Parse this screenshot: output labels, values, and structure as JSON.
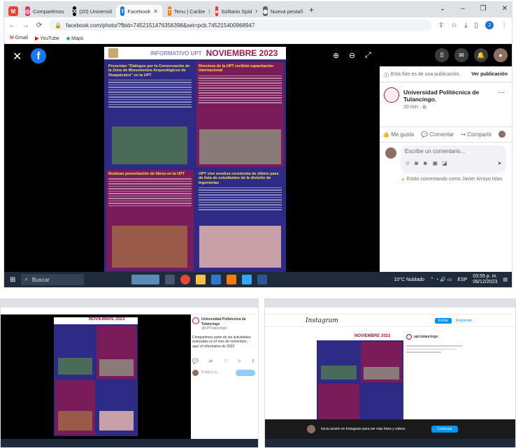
{
  "main": {
    "tabs": [
      {
        "label": "",
        "color": "#ea4335",
        "glyph": "M"
      },
      {
        "label": "Compartimos",
        "color": "#e1306c",
        "glyph": "◎"
      },
      {
        "label": "(20) Universid",
        "color": "#000000",
        "glyph": "X"
      },
      {
        "label": "Facebook",
        "color": "#1877f2",
        "glyph": "f"
      },
      {
        "label": "Tenu | Caribe",
        "color": "#f57c00",
        "glyph": "T"
      },
      {
        "label": "Solitario Spid",
        "color": "#e53935",
        "glyph": "♠"
      },
      {
        "label": "Nueva pestañ",
        "color": "#5f6368",
        "glyph": "◉"
      }
    ],
    "url": "facebook.com/photo/?fbid=7452151476356398&set=pcb.745215400968947",
    "bookmarks": [
      "Gmail",
      "YouTube",
      "Maps"
    ],
    "poster": {
      "header_label": "INFORMATIVO UPT",
      "month": "NOVIEMBRE 2023",
      "articles": [
        "Presentan \"Diálogos por la Conservación de la Zona de Monumentos Arqueológicos de Huapalcalco\" en la UPT",
        "Directora de la UPT recibirá capacitación internacional",
        "Realizan presentación de libros en la UPT",
        "UPT vive emotiva ceremonia de último pase de lista de estudiantes de la división de Ingenierías"
      ]
    },
    "side": {
      "notice": "Esta foto es de una publicación.",
      "view_post": "Ver publicación",
      "page_name": "Universidad Politécnica de Tulancingo.",
      "time": "20 min · ",
      "like": "Me gusta",
      "comment": "Comentar",
      "share": "Compartir",
      "comment_placeholder": "Escribe un comentario...",
      "commenting_as": "Estás comentando como Javier Arroyo Islas."
    },
    "taskbar": {
      "search": "Buscar",
      "weather": "10°C Nublado",
      "lang": "ESP",
      "time": "03:55 p. m.",
      "date": "06/12/2023"
    }
  },
  "twitter_shot": {
    "account": "Universidad Politécnica de Tulancingo",
    "handle": "@UPTulancingo",
    "tweet": "Compartimos parte de las actividades realizadas en el mes de noviembre, aquí el informativo de 2023",
    "reply_placeholder": "Publica tu..."
  },
  "instagram_shot": {
    "logo": "Instagram",
    "btn_login": "Entrar",
    "btn_signup": "Regístrate",
    "user": "upt.tulancingo",
    "banner": "Inicia sesión en Instagram para ver más fotos y videos",
    "banner_btn": "Continuar"
  }
}
